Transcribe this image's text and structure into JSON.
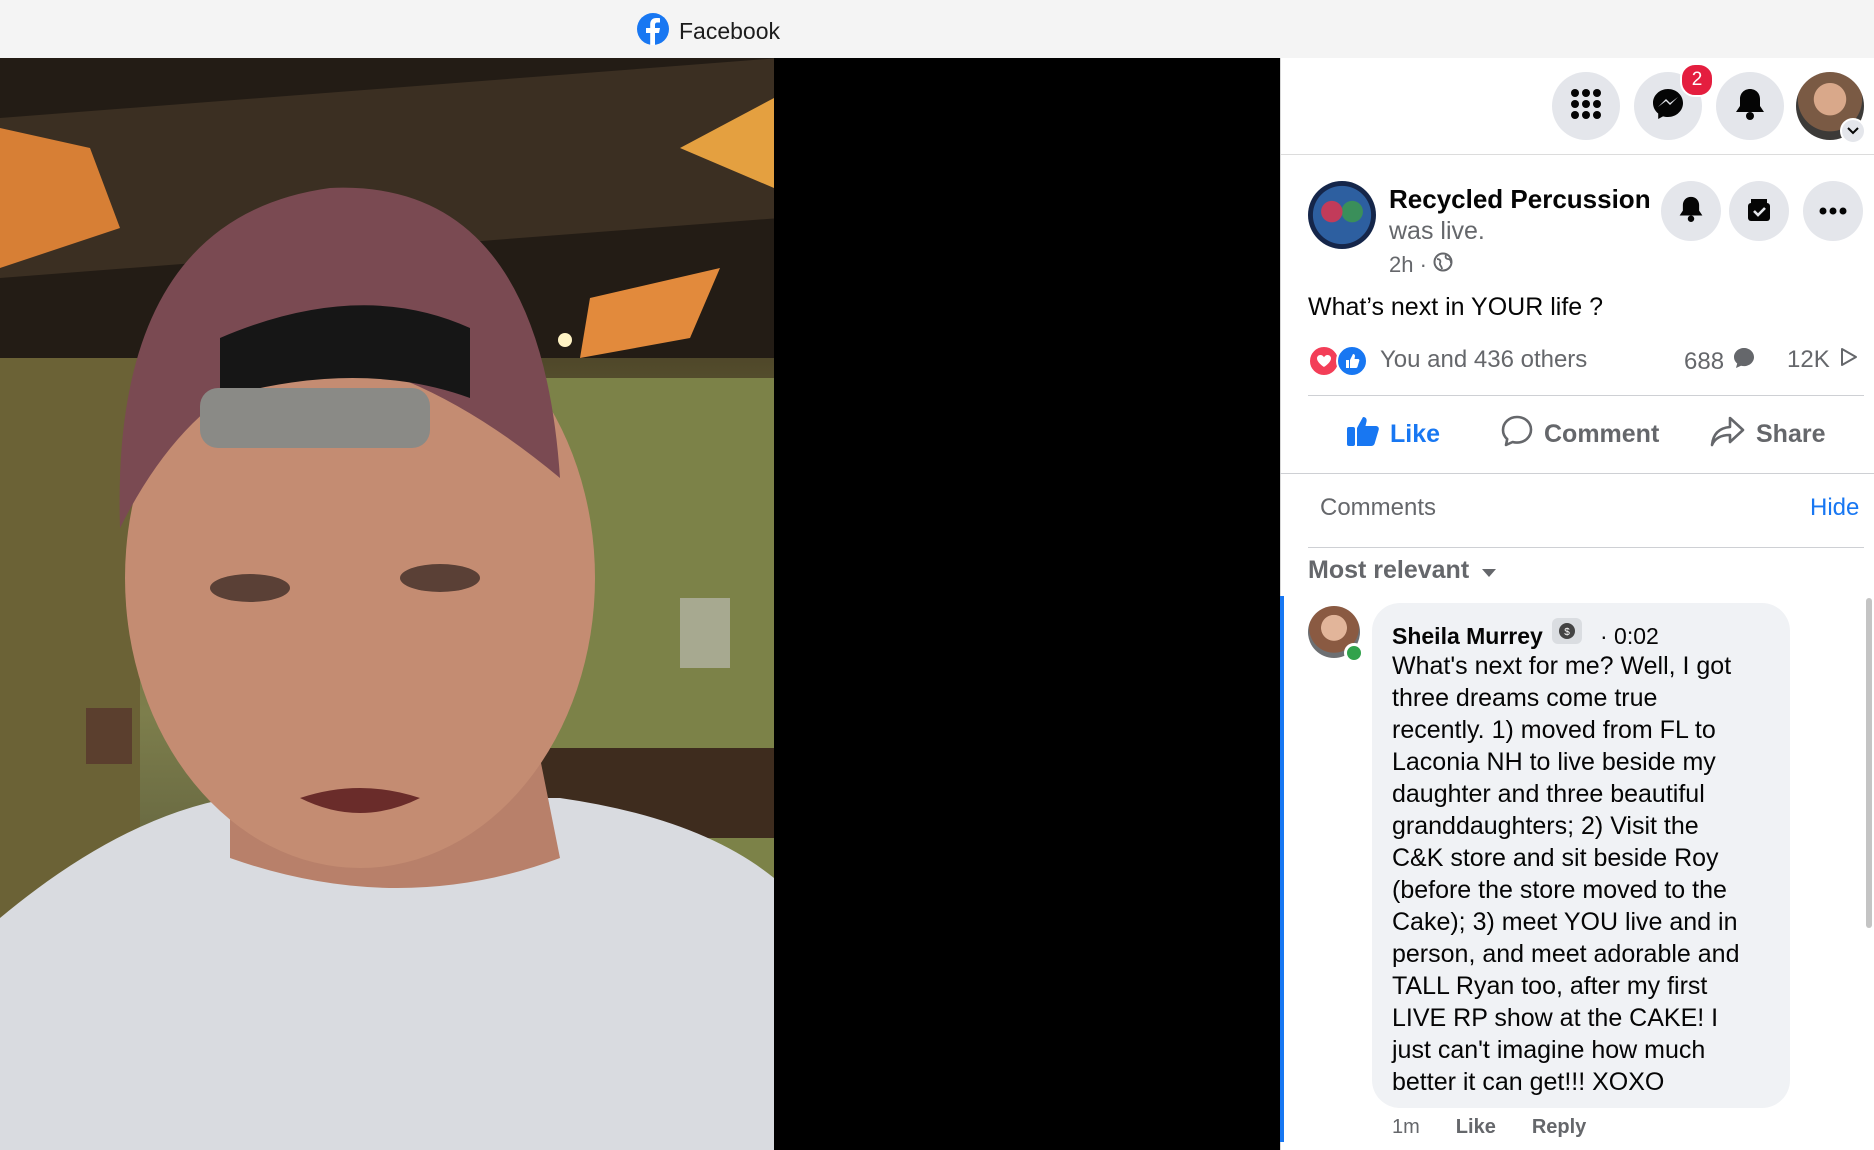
{
  "window": {
    "title": "Facebook"
  },
  "topbar": {
    "messenger_badge": "2"
  },
  "post": {
    "page_name": "Recycled Percussion",
    "status": "was live.",
    "time": "2h ·",
    "text": "What’s next in YOUR life ?",
    "reactions_text": "You and 436 others",
    "comment_count": "688",
    "view_count": "12K"
  },
  "actions": {
    "like": "Like",
    "comment": "Comment",
    "share": "Share"
  },
  "comments_section": {
    "header": "Comments",
    "hide": "Hide",
    "sort": "Most relevant"
  },
  "comment": {
    "author": "Sheila Murrey",
    "timestamp": "· 0:02",
    "text": "What's next for me? Well, I got\nthree dreams come true\nrecently. 1) moved from FL to\nLaconia NH to live beside my\ndaughter and three beautiful\ngranddaughters; 2) Visit the\nC&K store and sit beside Roy\n(before the store moved to the\nCake); 3) meet YOU live and in\nperson, and meet adorable and\nTALL Ryan too, after my first\nLIVE RP show at the CAKE! I\njust can't imagine how much\nbetter it can get!!! XOXO",
    "age": "1m",
    "like": "Like",
    "reply": "Reply"
  },
  "colors": {
    "accent": "#1877f2",
    "badge": "#e41e3f",
    "muted": "#65676b"
  }
}
